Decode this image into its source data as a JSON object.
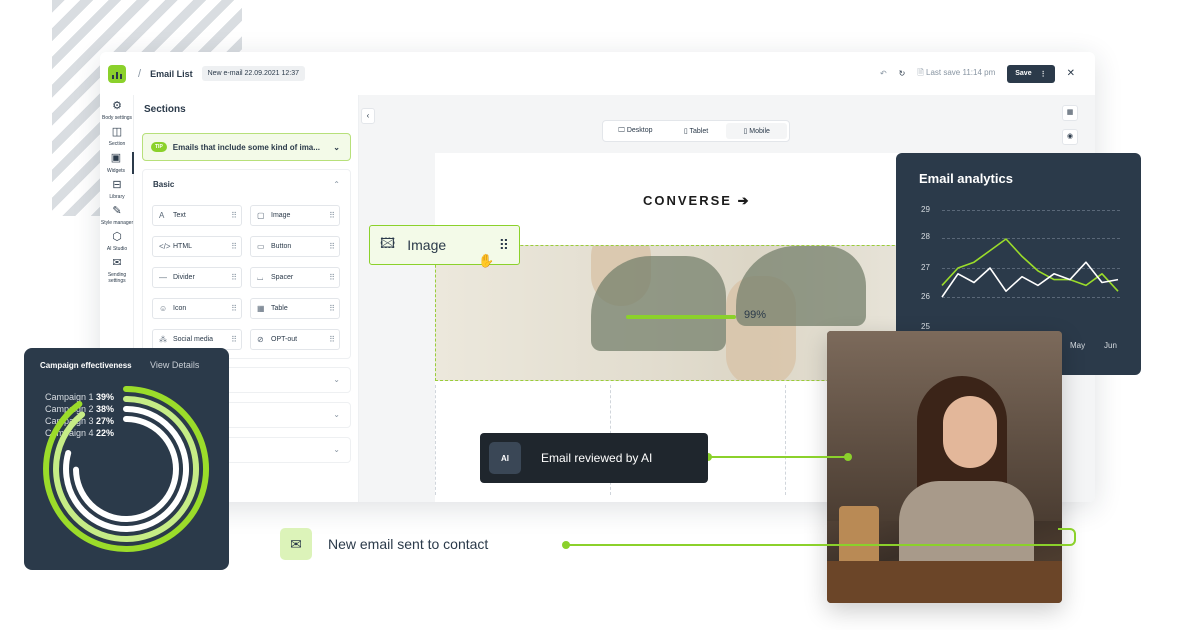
{
  "topbar": {
    "crumb": "Email List",
    "badge": "New e-mail 22.09.2021 12:37",
    "last_save": "Last save 11:14 pm",
    "save_label": "Save"
  },
  "sidebar": {
    "items": [
      {
        "label": "Body settings",
        "icon": "gear-icon"
      },
      {
        "label": "Section",
        "icon": "columns-icon"
      },
      {
        "label": "Widgets",
        "icon": "widgets-icon"
      },
      {
        "label": "Library",
        "icon": "library-icon"
      },
      {
        "label": "Style manager",
        "icon": "brush-icon"
      },
      {
        "label": "AI Studio",
        "icon": "ai-icon"
      },
      {
        "label": "Sending settings",
        "icon": "mail-icon"
      }
    ]
  },
  "sections": {
    "title": "Sections",
    "tip_badge": "TIP",
    "tip_text": "Emails that include some kind of ima...",
    "basic_title": "Basic",
    "widgets": [
      {
        "label": "Text",
        "glyph": "A"
      },
      {
        "label": "Image",
        "glyph": "▢"
      },
      {
        "label": "HTML",
        "glyph": "</>"
      },
      {
        "label": "Button",
        "glyph": "▭"
      },
      {
        "label": "Divider",
        "glyph": "—"
      },
      {
        "label": "Spacer",
        "glyph": "⌴"
      },
      {
        "label": "Icon",
        "glyph": "☺"
      },
      {
        "label": "Table",
        "glyph": "▦"
      },
      {
        "label": "Social media",
        "glyph": "⁂"
      },
      {
        "label": "OPT-out",
        "glyph": "⊘"
      }
    ]
  },
  "canvas": {
    "devices": [
      "Desktop",
      "Tablet",
      "Mobile"
    ],
    "active_device": "Mobile",
    "brand": "CONVERSE",
    "progress_pct": "99%"
  },
  "image_chip": {
    "label": "Image"
  },
  "analytics": {
    "title": "Email analytics",
    "y_ticks": [
      "29",
      "28",
      "27",
      "26",
      "25"
    ],
    "x_ticks": [
      "May",
      "Jun"
    ]
  },
  "campaign": {
    "title": "Campaign effectiveness",
    "view_details": "View Details",
    "rows": [
      {
        "label": "Campaign 1",
        "value": "39%"
      },
      {
        "label": "Campaign 2",
        "value": "38%"
      },
      {
        "label": "Campaign 3",
        "value": "27%"
      },
      {
        "label": "Campaign 4",
        "value": "22%"
      }
    ]
  },
  "reviewed": {
    "icon_label": "AI",
    "label": "Email reviewed by AI"
  },
  "notification": {
    "label": "New email sent to contact"
  },
  "colors": {
    "accent": "#8bd12b",
    "dark": "#2b3a4a"
  },
  "chart_data": [
    {
      "type": "line",
      "title": "Email analytics",
      "xlabel": "",
      "ylabel": "",
      "x_ticks": [
        "May",
        "Jun"
      ],
      "ylim": [
        25,
        29
      ],
      "grid": true,
      "series": [
        {
          "values": [
            26.4,
            27.0,
            27.2,
            27.6,
            28.0,
            27.4,
            26.9,
            26.6,
            26.6,
            26.4,
            26.8,
            26.2
          ]
        },
        {
          "values": [
            26.0,
            26.8,
            26.5,
            27.0,
            26.2,
            26.7,
            26.4,
            26.8,
            26.6,
            27.2,
            26.5,
            26.6
          ]
        }
      ]
    },
    {
      "type": "pie",
      "title": "Campaign effectiveness",
      "categories": [
        "Campaign 1",
        "Campaign 2",
        "Campaign 3",
        "Campaign 4"
      ],
      "values": [
        39,
        38,
        27,
        22
      ]
    }
  ]
}
